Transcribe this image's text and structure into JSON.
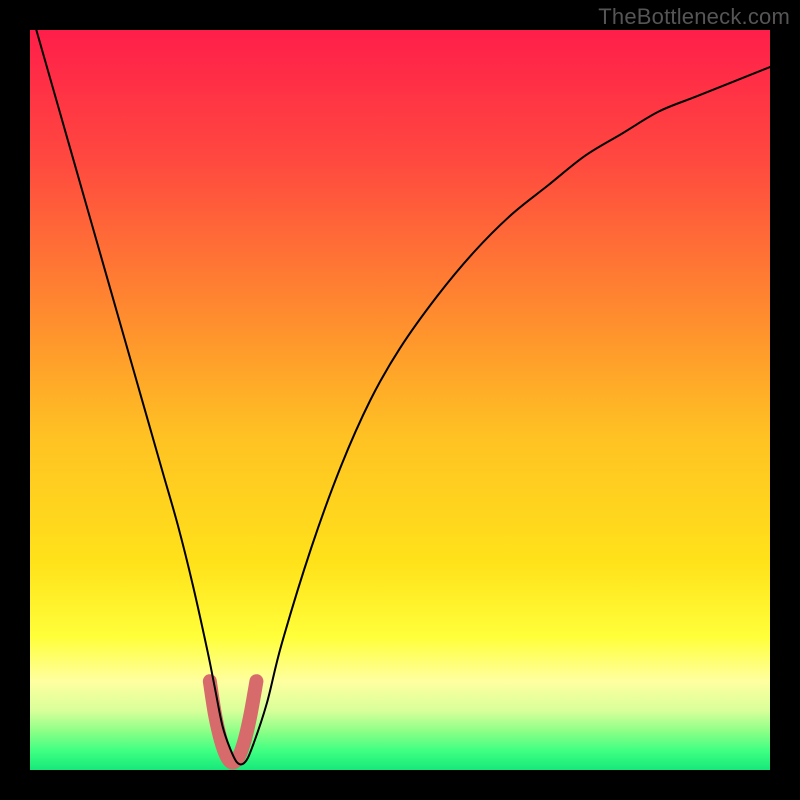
{
  "watermark": "TheBottleneck.com",
  "colors": {
    "bg": "#000000",
    "curve": "#000000",
    "marker": "#d76a6a",
    "gradient_stops": [
      {
        "offset": 0.0,
        "color": "#ff1e4a"
      },
      {
        "offset": 0.18,
        "color": "#ff4a3f"
      },
      {
        "offset": 0.38,
        "color": "#ff8a2f"
      },
      {
        "offset": 0.55,
        "color": "#ffc223"
      },
      {
        "offset": 0.72,
        "color": "#ffe21a"
      },
      {
        "offset": 0.82,
        "color": "#ffff3a"
      },
      {
        "offset": 0.88,
        "color": "#ffffa0"
      },
      {
        "offset": 0.92,
        "color": "#d8ff9a"
      },
      {
        "offset": 0.95,
        "color": "#86ff86"
      },
      {
        "offset": 0.975,
        "color": "#3dff82"
      },
      {
        "offset": 1.0,
        "color": "#17e87a"
      }
    ]
  },
  "chart_data": {
    "type": "line",
    "title": "",
    "xlabel": "",
    "ylabel": "",
    "xlim": [
      0,
      100
    ],
    "ylim": [
      0,
      100
    ],
    "series": [
      {
        "name": "bottleneck-curve",
        "x": [
          0,
          2,
          4,
          6,
          8,
          10,
          12,
          14,
          16,
          18,
          20,
          22,
          24,
          25,
          26,
          27,
          28,
          29,
          30,
          32,
          34,
          38,
          42,
          46,
          50,
          55,
          60,
          65,
          70,
          75,
          80,
          85,
          90,
          95,
          100
        ],
        "y": [
          103,
          96,
          89,
          82,
          75,
          68,
          61,
          54,
          47,
          40,
          33,
          25,
          16,
          11,
          6,
          3,
          1,
          1,
          3,
          9,
          17,
          30,
          41,
          50,
          57,
          64,
          70,
          75,
          79,
          83,
          86,
          89,
          91,
          93,
          95
        ]
      }
    ],
    "marker": {
      "name": "min-region-u",
      "x": [
        24.3,
        25.0,
        25.8,
        26.6,
        27.4,
        28.2,
        29.0,
        29.8,
        30.6
      ],
      "y": [
        12.0,
        7.5,
        4.0,
        1.8,
        1.0,
        1.8,
        4.0,
        7.5,
        12.0
      ]
    }
  }
}
